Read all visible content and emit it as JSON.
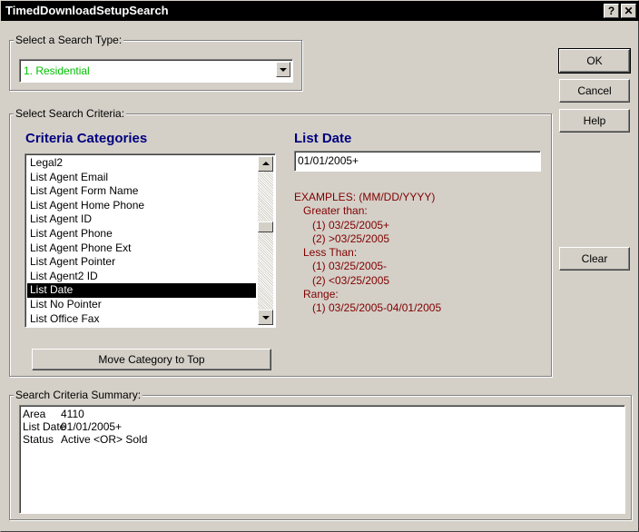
{
  "window": {
    "title": "TimedDownloadSetupSearch",
    "help_icon": "?",
    "close_icon": "✕"
  },
  "search_type": {
    "label": "Select a Search Type:",
    "selected": "1. Residential"
  },
  "buttons": {
    "ok": "OK",
    "cancel": "Cancel",
    "help": "Help",
    "clear": "Clear"
  },
  "criteria": {
    "group_label": "Select Search Criteria:",
    "categories_heading": "Criteria Categories",
    "items": [
      "Legal2",
      "List Agent Email",
      "List Agent Form Name",
      "List Agent Home Phone",
      "List Agent ID",
      "List Agent Phone",
      "List Agent Phone Ext",
      "List Agent Pointer",
      "List Agent2 ID",
      "List Date",
      "List No Pointer",
      "List Office Fax"
    ],
    "selected_index": 9,
    "move_button": "Move Category to Top"
  },
  "field": {
    "heading": "List Date",
    "value": "01/01/2005+",
    "examples": [
      "EXAMPLES: (MM/DD/YYYY)",
      "Greater than:",
      "(1) 03/25/2005+",
      "(2) >03/25/2005",
      "Less Than:",
      "(1) 03/25/2005-",
      "(2) <03/25/2005",
      "Range:",
      "(1) 03/25/2005-04/01/2005"
    ]
  },
  "summary": {
    "label": "Search Criteria Summary:",
    "rows": [
      {
        "field": "Area",
        "value": "4110"
      },
      {
        "field": "List Date",
        "value": "01/01/2005+"
      },
      {
        "field": "Status",
        "value": "Active <OR> Sold"
      }
    ]
  },
  "colors": {
    "title_bar": "#000000",
    "heading": "#00007f",
    "examples": "#800000",
    "combo_text": "#00c000"
  }
}
